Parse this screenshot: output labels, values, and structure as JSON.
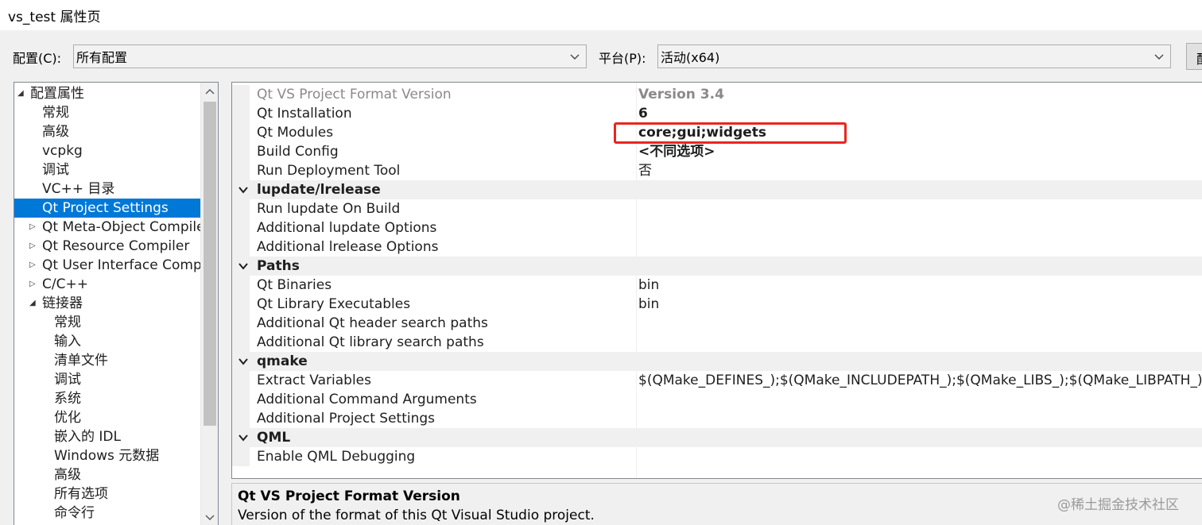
{
  "window": {
    "title": "vs_test 属性页"
  },
  "config": {
    "label": "配置(C):",
    "label_access": "C",
    "value": "所有配置",
    "platform_label": "平台(P):",
    "platform_value": "活动(x64)",
    "manager_button": "配"
  },
  "tree": {
    "items": [
      {
        "label": "配置属性",
        "expander": "expanded",
        "level": 0
      },
      {
        "label": "常规",
        "expander": "none",
        "level": 1
      },
      {
        "label": "高级",
        "expander": "none",
        "level": 1
      },
      {
        "label": "vcpkg",
        "expander": "none",
        "level": 1
      },
      {
        "label": "调试",
        "expander": "none",
        "level": 1
      },
      {
        "label": "VC++ 目录",
        "expander": "none",
        "level": 1
      },
      {
        "label": "Qt Project Settings",
        "expander": "none",
        "level": 1,
        "selected": true
      },
      {
        "label": "Qt Meta-Object Compile",
        "expander": "collapsed",
        "level": 1
      },
      {
        "label": "Qt Resource Compiler",
        "expander": "collapsed",
        "level": 1
      },
      {
        "label": "Qt User Interface Compil",
        "expander": "collapsed",
        "level": 1
      },
      {
        "label": "C/C++",
        "expander": "collapsed",
        "level": 1
      },
      {
        "label": "链接器",
        "expander": "expanded",
        "level": 1
      },
      {
        "label": "常规",
        "expander": "none",
        "level": 2
      },
      {
        "label": "输入",
        "expander": "none",
        "level": 2
      },
      {
        "label": "清单文件",
        "expander": "none",
        "level": 2
      },
      {
        "label": "调试",
        "expander": "none",
        "level": 2
      },
      {
        "label": "系统",
        "expander": "none",
        "level": 2
      },
      {
        "label": "优化",
        "expander": "none",
        "level": 2
      },
      {
        "label": "嵌入的 IDL",
        "expander": "none",
        "level": 2
      },
      {
        "label": "Windows 元数据",
        "expander": "none",
        "level": 2
      },
      {
        "label": "高级",
        "expander": "none",
        "level": 2
      },
      {
        "label": "所有选项",
        "expander": "none",
        "level": 2
      },
      {
        "label": "命令行",
        "expander": "none",
        "level": 2
      }
    ]
  },
  "grid": {
    "rows": [
      {
        "type": "prop",
        "name": "Qt VS Project Format Version",
        "value": "Version 3.4",
        "bold": true,
        "disabled": true
      },
      {
        "type": "prop",
        "name": "Qt Installation",
        "value": "6",
        "bold": true
      },
      {
        "type": "prop",
        "name": "Qt Modules",
        "value": "core;gui;widgets",
        "bold": true
      },
      {
        "type": "prop",
        "name": "Build Config",
        "value": "<不同选项>",
        "bold": true
      },
      {
        "type": "prop",
        "name": "Run Deployment Tool",
        "value": "否",
        "bold": false
      },
      {
        "type": "cat",
        "name": "lupdate/lrelease"
      },
      {
        "type": "prop",
        "name": "Run lupdate On Build",
        "value": "",
        "bold": false
      },
      {
        "type": "prop",
        "name": "Additional lupdate Options",
        "value": "",
        "bold": false
      },
      {
        "type": "prop",
        "name": "Additional lrelease Options",
        "value": "",
        "bold": false
      },
      {
        "type": "cat",
        "name": "Paths"
      },
      {
        "type": "prop",
        "name": "Qt Binaries",
        "value": "bin",
        "bold": false
      },
      {
        "type": "prop",
        "name": "Qt Library Executables",
        "value": "bin",
        "bold": false
      },
      {
        "type": "prop",
        "name": "Additional Qt header search paths",
        "value": "",
        "bold": false
      },
      {
        "type": "prop",
        "name": "Additional Qt library search paths",
        "value": "",
        "bold": false
      },
      {
        "type": "cat",
        "name": "qmake"
      },
      {
        "type": "prop",
        "name": "Extract Variables",
        "value": "$(QMake_DEFINES_);$(QMake_INCLUDEPATH_);$(QMake_LIBS_);$(QMake_LIBPATH_)",
        "bold": false
      },
      {
        "type": "prop",
        "name": "Additional Command Arguments",
        "value": "",
        "bold": false
      },
      {
        "type": "prop",
        "name": "Additional Project Settings",
        "value": "",
        "bold": false
      },
      {
        "type": "cat",
        "name": "QML"
      },
      {
        "type": "prop",
        "name": "Enable QML Debugging",
        "value": "",
        "bold": false
      }
    ]
  },
  "description": {
    "title": "Qt VS Project Format Version",
    "text": "Version of the format of this Qt Visual Studio project."
  },
  "watermark": "@稀土掘金技术社区",
  "colors": {
    "selection": "#0078d7",
    "highlight_box": "#e8261f"
  }
}
